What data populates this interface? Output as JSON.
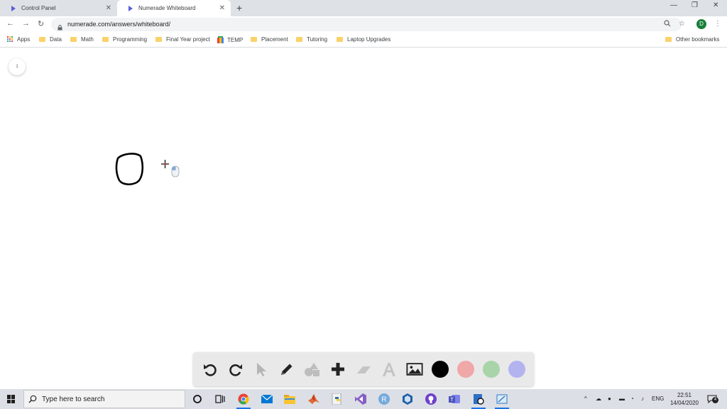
{
  "tabs": [
    {
      "title": "Control Panel",
      "active": false
    },
    {
      "title": "Numerade Whiteboard",
      "active": true
    }
  ],
  "omnibox": {
    "url": "numerade.com/answers/whiteboard/"
  },
  "profile_initial": "D",
  "bookmarks": {
    "apps_label": "Apps",
    "items": [
      "Data",
      "Math",
      "Programming",
      "Final Year project",
      "TEMP",
      "Placement",
      "Tutoring",
      "Laptop Upgrades"
    ],
    "other_label": "Other bookmarks"
  },
  "whiteboard": {
    "page_number": "1",
    "colors": {
      "black": "#000000",
      "red": "#f0a7a7",
      "green": "#a9d4a9",
      "blue": "#b3b3f0"
    }
  },
  "taskbar": {
    "search_placeholder": "Type here to search",
    "language": "ENG",
    "time": "22:51",
    "date": "14/04/2020",
    "notification_count": "4"
  }
}
